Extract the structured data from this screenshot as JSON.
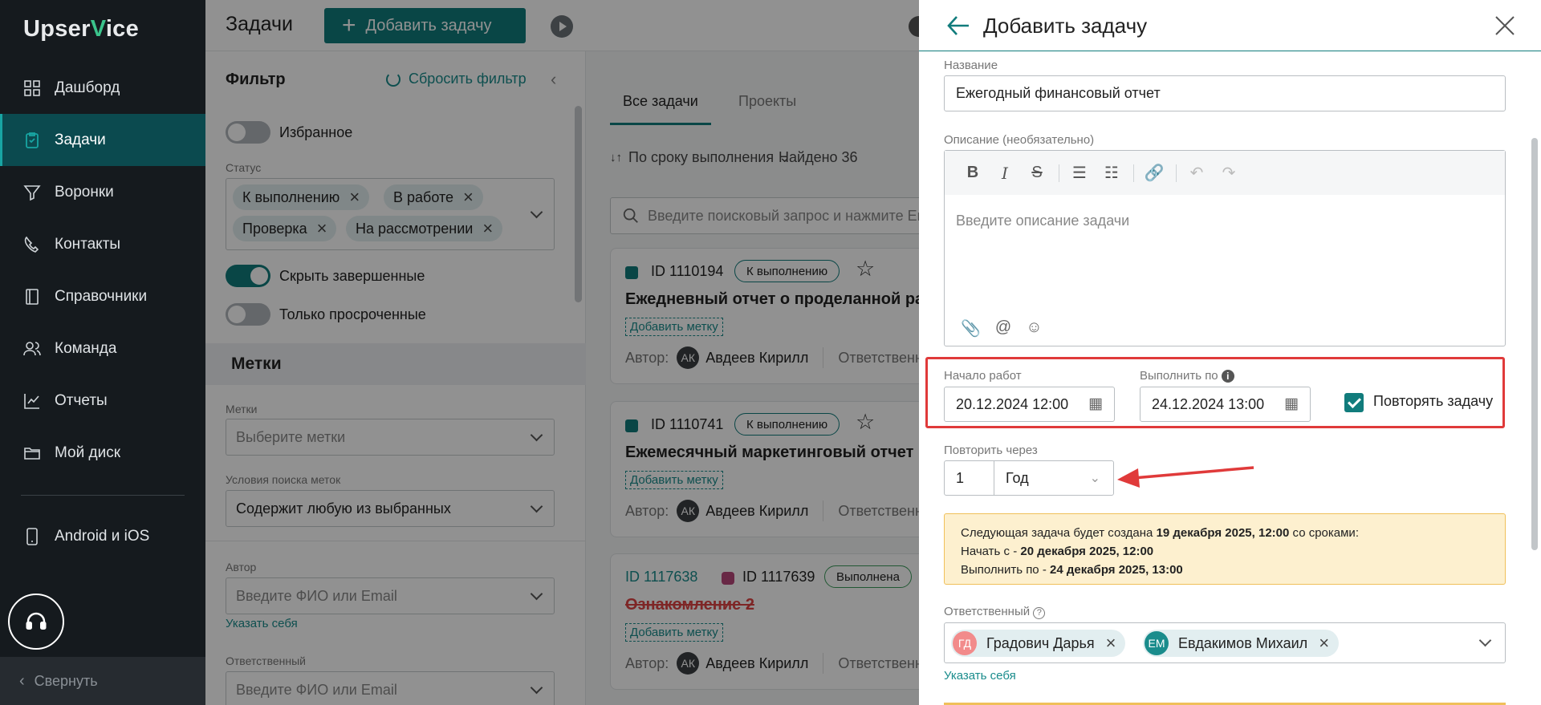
{
  "sidebar": {
    "logo_pre": "Upser",
    "logo_v": "V",
    "logo_post": "ice",
    "items": [
      {
        "label": "Дашборд",
        "icon": "dashboard-icon"
      },
      {
        "label": "Задачи",
        "icon": "tasks-icon",
        "active": true
      },
      {
        "label": "Воронки",
        "icon": "funnel-icon"
      },
      {
        "label": "Контакты",
        "icon": "contacts-icon"
      },
      {
        "label": "Справочники",
        "icon": "book-icon"
      },
      {
        "label": "Команда",
        "icon": "team-icon"
      },
      {
        "label": "Отчеты",
        "icon": "chart-icon"
      },
      {
        "label": "Мой диск",
        "icon": "folder-icon"
      },
      {
        "label": "Android и iOS",
        "icon": "phone-icon"
      }
    ],
    "collapse_label": "Свернуть"
  },
  "header": {
    "title": "Задачи",
    "add_task": "Добавить задачу"
  },
  "filter": {
    "title": "Фильтр",
    "reset": "Сбросить фильтр",
    "favorites": "Избранное",
    "status_label": "Статус",
    "status_chips": [
      "К выполнению",
      "В работе",
      "Проверка",
      "На рассмотрении"
    ],
    "hide_completed": "Скрыть завершенные",
    "only_overdue": "Только просроченные",
    "tags_section": "Метки",
    "tags_label": "Метки",
    "tags_placeholder": "Выберите метки",
    "tag_cond_label": "Условия поиска меток",
    "tag_cond_value": "Содержит любую из выбранных",
    "author_label": "Автор",
    "author_placeholder": "Введите ФИО или Email",
    "assign_self": "Указать себя",
    "resp_label": "Ответственный",
    "resp_placeholder": "Введите ФИО или Email"
  },
  "list": {
    "tab_all": "Все задачи",
    "tab_projects": "Проекты",
    "sort": "По сроку выполнения",
    "found": "Найдено 36",
    "search_placeholder": "Введите поисковый запрос и нажмите Enter",
    "cards": [
      {
        "id": "ID 1110194",
        "status": "К выполнению",
        "title": "Ежедневный отчет о проделанной работе",
        "mark": "Добавить метку",
        "author_label": "Автор:",
        "author_initials": "АК",
        "author": "Авдеев Кирилл",
        "resp_label": "Ответственный"
      },
      {
        "id": "ID 1110741",
        "status": "К выполнению",
        "title": "Ежемесячный маркетинговый отчет",
        "mark": "Добавить метку",
        "author_label": "Автор:",
        "author_initials": "АК",
        "author": "Авдеев Кирилл",
        "resp_label": "Ответственный"
      },
      {
        "parent_id": "ID 1117638",
        "id": "ID 1117639",
        "status": "Выполнена",
        "title": "Ознакомление 2",
        "mark": "Добавить метку",
        "author_label": "Автор:",
        "author_initials": "АК",
        "author": "Авдеев Кирилл",
        "resp_label": "Ответственный"
      }
    ]
  },
  "modal": {
    "title": "Добавить задачу",
    "name_label": "Название",
    "name_value": "Ежегодный финансовый отчет",
    "desc_label": "Описание (необязательно)",
    "desc_placeholder": "Введите описание задачи",
    "start_label": "Начало работ",
    "start_value": "20.12.2024 12:00",
    "due_label": "Выполнить по",
    "due_value": "24.12.2024 13:00",
    "repeat_label": "Повторять задачу",
    "repeat_every_label": "Повторить через",
    "repeat_count": "1",
    "repeat_unit": "Год",
    "info_line1_pre": "Следующая задача будет создана ",
    "info_line1_bold": "19 декабря 2025, 12:00",
    "info_line1_post": " со сроками:",
    "info_line2_pre": "Начать с - ",
    "info_line2_bold": "20 декабря 2025, 12:00",
    "info_line3_pre": "Выполнить по - ",
    "info_line3_bold": "24 декабря 2025, 13:00",
    "resp_label": "Ответственный",
    "assignees": [
      {
        "initials": "ГД",
        "name": "Градович Дарья",
        "color": "#f28b8b"
      },
      {
        "initials": "ЕМ",
        "name": "Евдакимов Михаил",
        "color": "#1a8c8c"
      }
    ],
    "assign_self": "Указать себя"
  },
  "colors": {
    "accent": "#117c7c",
    "highlight": "#e03a3a",
    "info_bg": "#fdf0cf"
  }
}
